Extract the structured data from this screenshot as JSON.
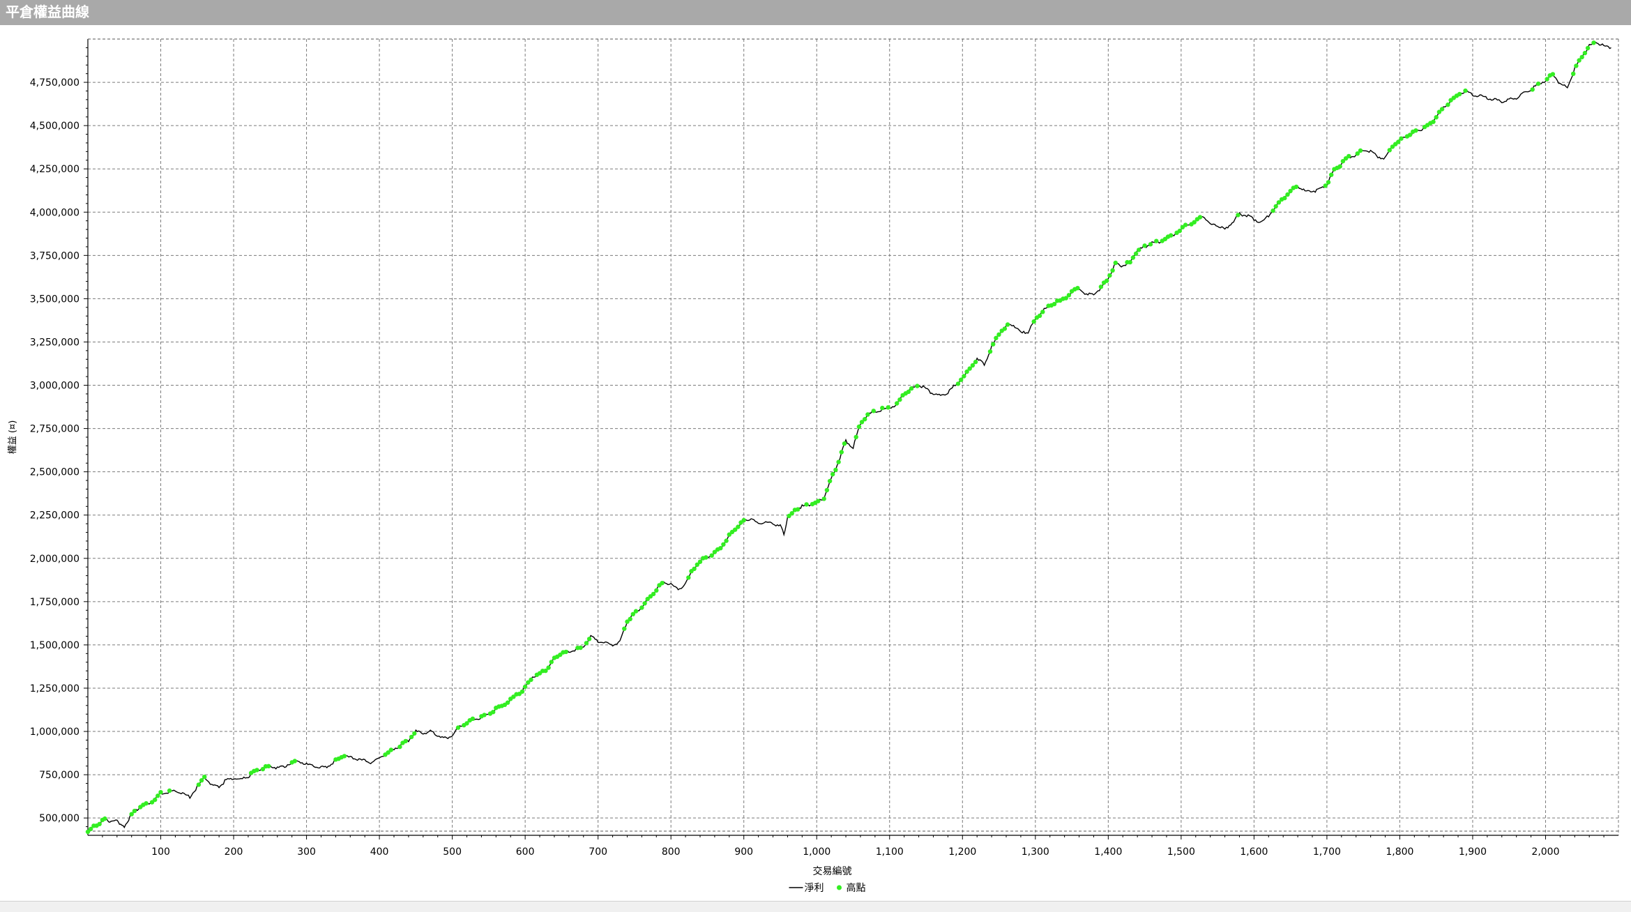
{
  "window": {
    "title": "平倉權益曲線"
  },
  "chart_data": {
    "type": "line",
    "title": "",
    "xlabel": "交易編號",
    "ylabel": "權益 (¤)",
    "xlim": [
      0,
      2100
    ],
    "ylim": [
      400000,
      5000000
    ],
    "x_ticks": [
      100,
      200,
      300,
      400,
      500,
      600,
      700,
      800,
      900,
      1000,
      1100,
      1200,
      1300,
      1400,
      1500,
      1600,
      1700,
      1800,
      1900,
      2000
    ],
    "x_tick_labels": [
      "100",
      "200",
      "300",
      "400",
      "500",
      "600",
      "700",
      "800",
      "900",
      "1,000",
      "1,100",
      "1,200",
      "1,300",
      "1,400",
      "1,500",
      "1,600",
      "1,700",
      "1,800",
      "1,900",
      "2,000"
    ],
    "y_ticks": [
      500000,
      750000,
      1000000,
      1250000,
      1500000,
      1750000,
      2000000,
      2250000,
      2500000,
      2750000,
      3000000,
      3250000,
      3500000,
      3750000,
      4000000,
      4250000,
      4500000,
      4750000
    ],
    "y_tick_labels": [
      "500,000",
      "750,000",
      "1,000,000",
      "1,250,000",
      "1,500,000",
      "1,750,000",
      "2,000,000",
      "2,250,000",
      "2,500,000",
      "2,750,000",
      "3,000,000",
      "3,250,000",
      "3,500,000",
      "3,750,000",
      "4,000,000",
      "4,250,000",
      "4,500,000",
      "4,750,000"
    ],
    "grid": true,
    "legend_position": "bottom-center",
    "series": [
      {
        "name": "淨利",
        "kind": "line",
        "color": "#000000",
        "x": [
          0,
          10,
          20,
          25,
          30,
          40,
          45,
          50,
          60,
          70,
          80,
          90,
          100,
          110,
          120,
          130,
          140,
          150,
          160,
          170,
          180,
          190,
          200,
          210,
          220,
          230,
          240,
          250,
          260,
          270,
          280,
          290,
          300,
          310,
          320,
          330,
          340,
          350,
          360,
          370,
          380,
          390,
          400,
          410,
          420,
          430,
          440,
          450,
          460,
          470,
          480,
          490,
          500,
          510,
          520,
          530,
          540,
          550,
          560,
          570,
          580,
          590,
          600,
          610,
          620,
          630,
          640,
          650,
          660,
          670,
          680,
          690,
          700,
          710,
          720,
          730,
          740,
          750,
          760,
          770,
          780,
          790,
          800,
          810,
          820,
          830,
          840,
          850,
          860,
          870,
          880,
          890,
          900,
          910,
          920,
          930,
          940,
          950,
          955,
          960,
          970,
          980,
          990,
          1000,
          1010,
          1020,
          1030,
          1040,
          1050,
          1060,
          1070,
          1080,
          1090,
          1100,
          1110,
          1120,
          1130,
          1140,
          1150,
          1160,
          1170,
          1180,
          1190,
          1200,
          1210,
          1220,
          1230,
          1240,
          1250,
          1260,
          1270,
          1280,
          1290,
          1300,
          1310,
          1320,
          1330,
          1340,
          1350,
          1360,
          1370,
          1380,
          1390,
          1400,
          1410,
          1420,
          1430,
          1440,
          1450,
          1460,
          1470,
          1480,
          1490,
          1500,
          1510,
          1520,
          1530,
          1540,
          1550,
          1560,
          1570,
          1580,
          1590,
          1600,
          1610,
          1620,
          1630,
          1640,
          1650,
          1660,
          1670,
          1680,
          1690,
          1700,
          1710,
          1720,
          1730,
          1740,
          1750,
          1760,
          1770,
          1780,
          1790,
          1800,
          1810,
          1820,
          1830,
          1840,
          1850,
          1860,
          1870,
          1880,
          1890,
          1900,
          1910,
          1920,
          1930,
          1940,
          1950,
          1960,
          1970,
          1980,
          1990,
          2000,
          2010,
          2020,
          2030,
          2040,
          2050,
          2060,
          2070,
          2080,
          2090
        ],
        "y": [
          420000,
          460000,
          480000,
          500000,
          470000,
          490000,
          460000,
          450000,
          520000,
          560000,
          580000,
          600000,
          640000,
          650000,
          660000,
          640000,
          620000,
          680000,
          740000,
          690000,
          680000,
          720000,
          730000,
          720000,
          740000,
          770000,
          790000,
          800000,
          790000,
          800000,
          820000,
          830000,
          810000,
          800000,
          790000,
          800000,
          830000,
          860000,
          850000,
          840000,
          830000,
          820000,
          850000,
          870000,
          900000,
          920000,
          950000,
          1000000,
          990000,
          1000000,
          980000,
          960000,
          980000,
          1030000,
          1050000,
          1070000,
          1080000,
          1100000,
          1130000,
          1150000,
          1180000,
          1220000,
          1250000,
          1320000,
          1330000,
          1360000,
          1420000,
          1450000,
          1460000,
          1470000,
          1490000,
          1550000,
          1520000,
          1510000,
          1500000,
          1520000,
          1640000,
          1680000,
          1720000,
          1770000,
          1820000,
          1860000,
          1850000,
          1820000,
          1850000,
          1940000,
          1980000,
          2010000,
          2030000,
          2070000,
          2130000,
          2180000,
          2220000,
          2230000,
          2200000,
          2210000,
          2200000,
          2190000,
          2140000,
          2230000,
          2280000,
          2300000,
          2310000,
          2320000,
          2350000,
          2460000,
          2560000,
          2680000,
          2640000,
          2780000,
          2830000,
          2850000,
          2860000,
          2870000,
          2890000,
          2950000,
          2980000,
          3000000,
          2980000,
          2950000,
          2940000,
          2960000,
          3000000,
          3040000,
          3100000,
          3150000,
          3120000,
          3220000,
          3300000,
          3340000,
          3350000,
          3300000,
          3310000,
          3380000,
          3430000,
          3460000,
          3480000,
          3500000,
          3540000,
          3560000,
          3520000,
          3530000,
          3560000,
          3620000,
          3700000,
          3690000,
          3710000,
          3780000,
          3800000,
          3820000,
          3830000,
          3850000,
          3870000,
          3900000,
          3930000,
          3950000,
          3980000,
          3930000,
          3920000,
          3900000,
          3940000,
          3990000,
          3980000,
          3960000,
          3940000,
          3980000,
          4030000,
          4080000,
          4120000,
          4150000,
          4120000,
          4120000,
          4130000,
          4160000,
          4240000,
          4280000,
          4320000,
          4330000,
          4360000,
          4350000,
          4320000,
          4310000,
          4380000,
          4420000,
          4440000,
          4460000,
          4480000,
          4500000,
          4550000,
          4600000,
          4640000,
          4680000,
          4700000,
          4680000,
          4670000,
          4660000,
          4650000,
          4640000,
          4650000,
          4660000,
          4690000,
          4710000,
          4740000,
          4760000,
          4800000,
          4740000,
          4720000,
          4830000,
          4900000,
          4960000,
          4980000,
          4960000,
          4950000
        ]
      },
      {
        "name": "高點",
        "kind": "markers",
        "color": "#33ee22"
      }
    ]
  }
}
